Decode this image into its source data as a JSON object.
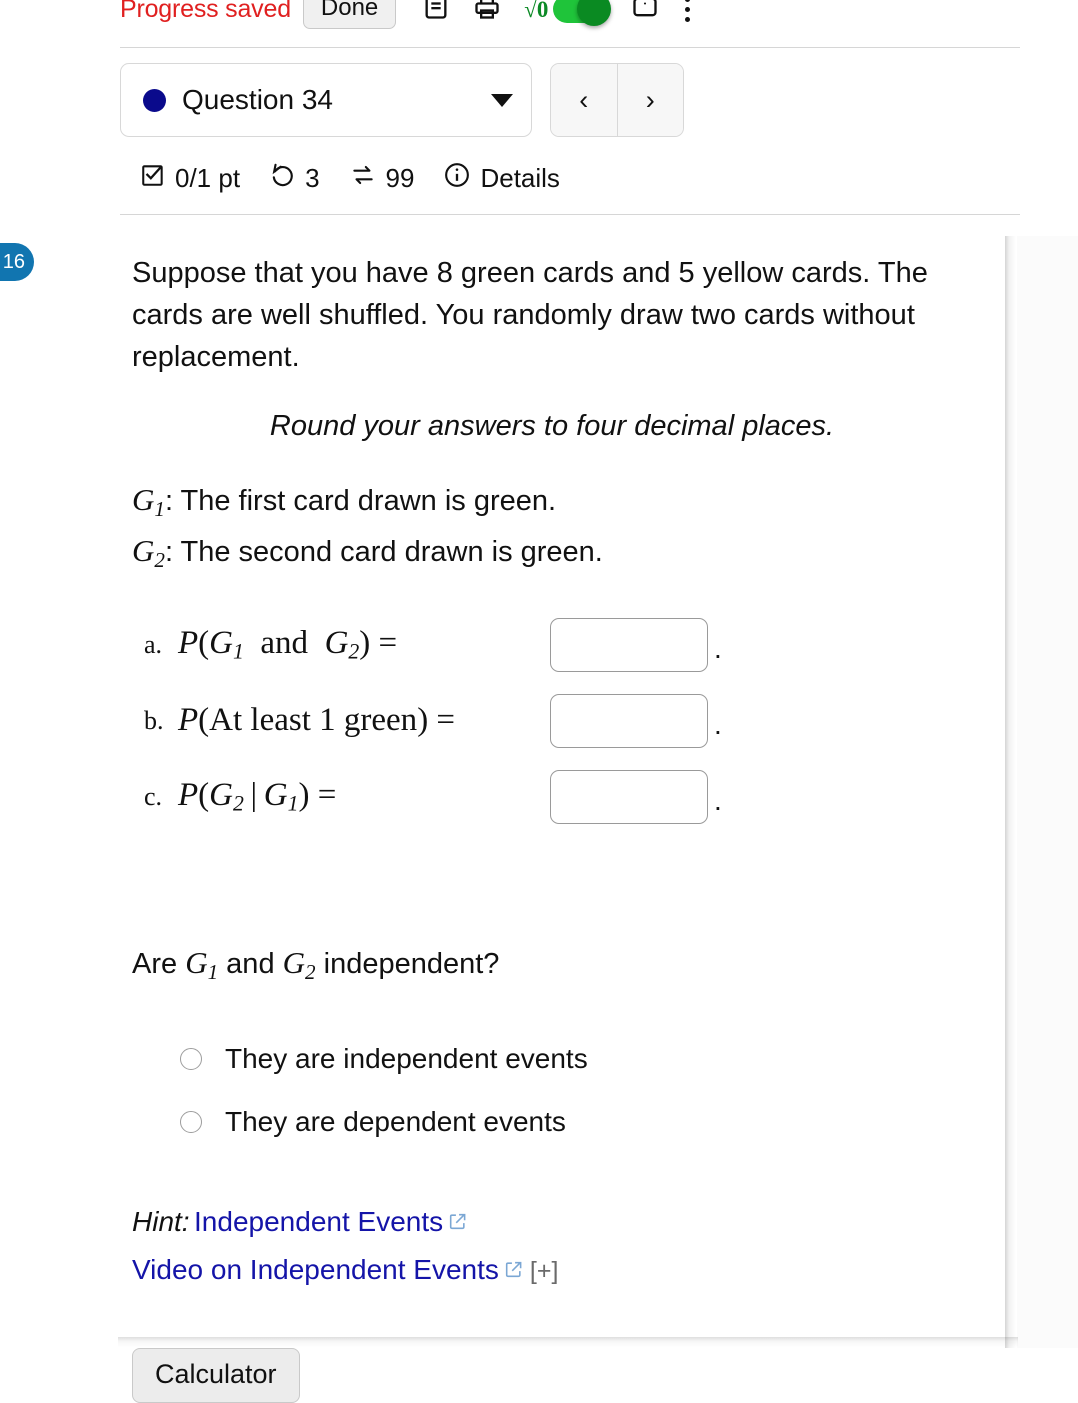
{
  "topbar": {
    "progress_status": "Progress saved",
    "done_label": "Done",
    "icons": [
      "notes-icon",
      "print-icon",
      "math-mode-toggle",
      "fullscreen-icon",
      "kebab-menu-icon"
    ],
    "math_toggle_label": "√0",
    "math_toggle_on": true,
    "status_color": "#e02020",
    "toggle_color": "#1fc43a"
  },
  "question_nav": {
    "dot_color": "#0a0a8c",
    "selected_question": "Question 34",
    "prev_label": "‹",
    "next_label": "›"
  },
  "details": {
    "score": "0/1 pt",
    "attempts": "3",
    "versions": "99",
    "details_label": "Details"
  },
  "side_badge": {
    "number": "16",
    "color": "#1175b0"
  },
  "question": {
    "stem": "Suppose that you have 8 green cards and 5 yellow cards. The cards are well shuffled. You randomly draw two cards without replacement.",
    "rounding_note": "Round your answers to four decimal places.",
    "event_defs": [
      {
        "symbol": "G",
        "sub": "1",
        "text": ": The first card drawn is green."
      },
      {
        "symbol": "G",
        "sub": "2",
        "text": ": The second card drawn is green."
      }
    ],
    "parts": [
      {
        "letter": "a.",
        "expr_parts": [
          {
            "t": "P(",
            "style": "italic"
          },
          {
            "t": "G",
            "style": "italic"
          },
          {
            "t": "1",
            "style": "sub"
          },
          {
            "t": " and ",
            "style": "roman"
          },
          {
            "t": "G",
            "style": "italic"
          },
          {
            "t": "2",
            "style": "sub"
          },
          {
            "t": ") =",
            "style": "italic"
          }
        ],
        "expr_text": "P(G1 and G2) =",
        "value": "",
        "placeholder": "",
        "trailing": "."
      },
      {
        "letter": "b.",
        "expr_parts": [
          {
            "t": "P(",
            "style": "italic"
          },
          {
            "t": "At least 1 green",
            "style": "roman"
          },
          {
            "t": ") =",
            "style": "italic"
          }
        ],
        "expr_text": "P(At least 1 green) =",
        "value": "",
        "placeholder": "",
        "trailing": "."
      },
      {
        "letter": "c.",
        "expr_parts": [
          {
            "t": "P(",
            "style": "italic"
          },
          {
            "t": "G",
            "style": "italic"
          },
          {
            "t": "2",
            "style": "sub"
          },
          {
            "t": " | ",
            "style": "roman"
          },
          {
            "t": "G",
            "style": "italic"
          },
          {
            "t": "1",
            "style": "sub"
          },
          {
            "t": ") =",
            "style": "italic"
          }
        ],
        "expr_text": "P(G2 | G1) =",
        "value": "",
        "placeholder": "",
        "trailing": "."
      }
    ],
    "independence_prompt_pre": "Are ",
    "independence_prompt_mid": " and ",
    "independence_prompt_post": " independent?",
    "independence_var1": "G",
    "independence_var1_sub": "1",
    "independence_var2": "G",
    "independence_var2_sub": "2",
    "choices": [
      {
        "label": "They are independent events",
        "selected": false
      },
      {
        "label": "They are dependent events",
        "selected": false
      }
    ]
  },
  "hints": {
    "hint_label": "Hint:",
    "hint_link": "Independent Events",
    "video_link": "Video on Independent Events",
    "expand_label": "[+]",
    "link_color": "#1414a8"
  },
  "footer": {
    "calculator_label": "Calculator"
  }
}
